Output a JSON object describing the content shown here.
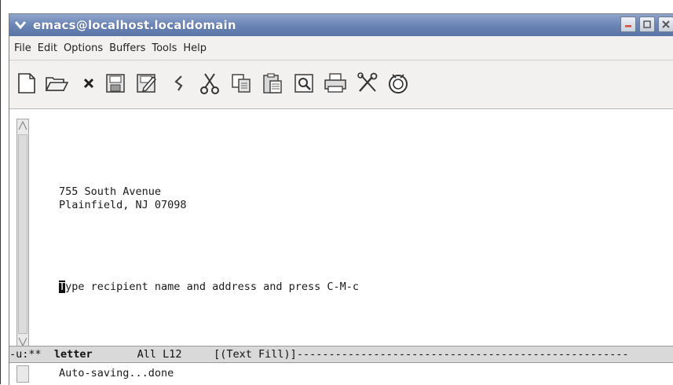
{
  "window": {
    "title": "emacs@localhost.localdomain",
    "controls": [
      "minimize-icon",
      "maximize-icon",
      "close-icon"
    ]
  },
  "menubar": {
    "items": [
      "File",
      "Edit",
      "Options",
      "Buffers",
      "Tools",
      "Help"
    ]
  },
  "toolbar": {
    "buttons": [
      "new-file-icon",
      "open-folder-icon",
      "close-buffer-icon",
      "save-icon",
      "save-as-icon",
      "undo-icon",
      "cut-icon",
      "copy-icon",
      "paste-icon",
      "search-icon",
      "print-icon",
      "preferences-icon",
      "info-icon"
    ]
  },
  "buffer": {
    "lines": [
      "755 South Avenue",
      "Plainfield, NJ 07098",
      "ype recipient name and address and press C-M-c"
    ],
    "cursor_char": "T"
  },
  "modeline": {
    "prefix": "-u:**  ",
    "buffer_name": "letter",
    "gap": "       ",
    "position": "All L12",
    "gap2": "     ",
    "mode": "[(Text Fill)]",
    "fill": "----------------------------------------------------"
  },
  "minibuffer": {
    "message": "Auto-saving...done"
  },
  "colors": {
    "titlebar": "#6b85b5",
    "menubar": "#f2f1ef",
    "modeline": "#d9d9d9"
  }
}
